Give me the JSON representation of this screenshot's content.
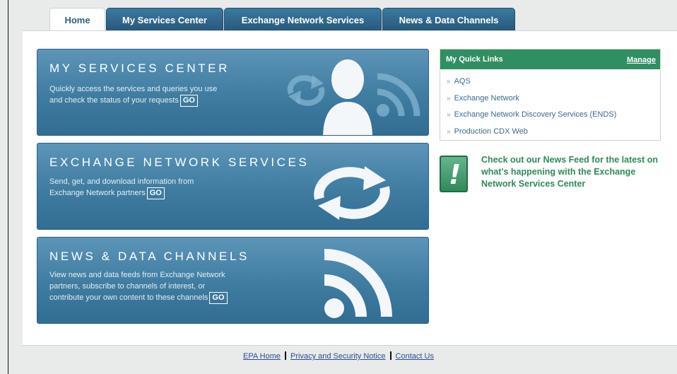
{
  "tabs": [
    {
      "label": "Home",
      "active": true
    },
    {
      "label": "My Services Center",
      "active": false
    },
    {
      "label": "Exchange Network Services",
      "active": false
    },
    {
      "label": "News & Data Channels",
      "active": false
    }
  ],
  "panels": {
    "services": {
      "title": "MY SERVICES CENTER",
      "desc_line1": "Quickly access the services and queries you use",
      "desc_line2": "and check the status of your requests",
      "go": "GO"
    },
    "exchange": {
      "title": "EXCHANGE NETWORK SERVICES",
      "desc_line1": "Send, get, and download information from",
      "desc_line2": "Exchange Network partners",
      "go": "GO"
    },
    "news": {
      "title": "NEWS & DATA CHANNELS",
      "desc_line1": "View news and data feeds from Exchange Network",
      "desc_line2": "partners, subscribe to channels of interest, or",
      "desc_line3": "contribute your own content to these channels",
      "go": "GO"
    }
  },
  "quick_links": {
    "title": "My Quick Links",
    "manage": "Manage",
    "bullet": "»",
    "items": [
      "AQS",
      "Exchange Network",
      "Exchange Network Discovery Services (ENDS)",
      "Production CDX Web"
    ]
  },
  "news_callout": {
    "icon_glyph": "!",
    "text": "Check out our News Feed for the latest on what's happening with the Exchange Network Services Center"
  },
  "footer": {
    "links": [
      "EPA Home",
      "Privacy and Security Notice",
      "Contact Us"
    ]
  },
  "colors": {
    "tab_blue": "#2f6a90",
    "panel_blue": "#4a86aa",
    "quick_green": "#2f8f62",
    "news_green": "#2e8a5a",
    "link_blue": "#3a6b8c"
  },
  "icons": {
    "services": [
      "refresh-arrows-icon",
      "person-silhouette-icon",
      "rss-feed-icon"
    ],
    "exchange": "exchange-arrows-icon",
    "news": "rss-feed-icon",
    "callout": "exclamation-icon"
  }
}
